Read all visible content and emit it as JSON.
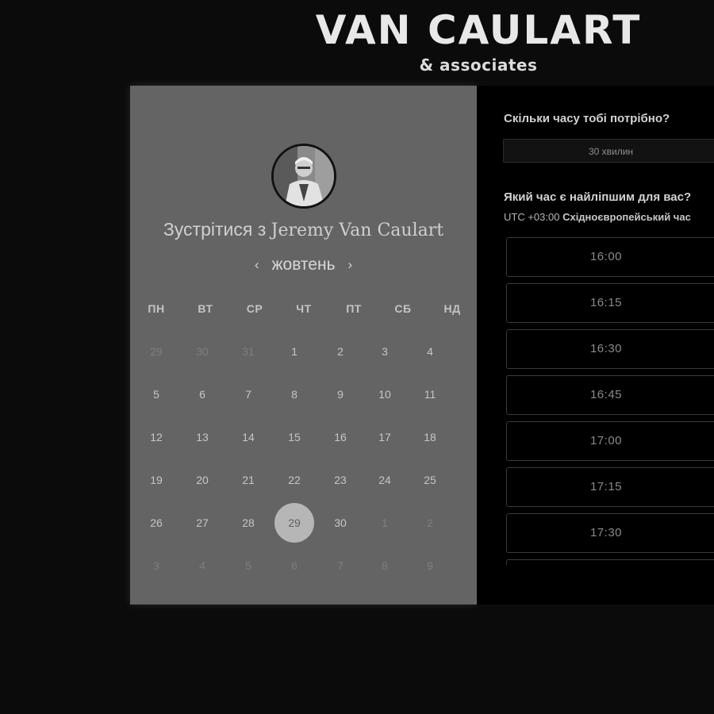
{
  "brand": {
    "title": "VAN CAULART",
    "subtitle": "& associates"
  },
  "host": {
    "prefix": "Зустрітися з",
    "name": "Jeremy Van Caulart",
    "avatar_icon": "host-avatar-photo"
  },
  "calendar": {
    "month": "жовтень",
    "prev_icon": "chevron-left-icon",
    "next_icon": "chevron-right-icon",
    "weekdays": [
      "ПН",
      "ВТ",
      "СР",
      "ЧТ",
      "ПТ",
      "СБ",
      "НД"
    ],
    "weeks": [
      [
        {
          "d": "29",
          "other": true
        },
        {
          "d": "30",
          "other": true
        },
        {
          "d": "31",
          "other": true
        },
        {
          "d": "1"
        },
        {
          "d": "2"
        },
        {
          "d": "3"
        },
        {
          "d": "4"
        }
      ],
      [
        {
          "d": "5"
        },
        {
          "d": "6"
        },
        {
          "d": "7"
        },
        {
          "d": "8"
        },
        {
          "d": "9"
        },
        {
          "d": "10"
        },
        {
          "d": "11"
        }
      ],
      [
        {
          "d": "12"
        },
        {
          "d": "13"
        },
        {
          "d": "14"
        },
        {
          "d": "15"
        },
        {
          "d": "16"
        },
        {
          "d": "17"
        },
        {
          "d": "18"
        }
      ],
      [
        {
          "d": "19"
        },
        {
          "d": "20"
        },
        {
          "d": "21"
        },
        {
          "d": "22"
        },
        {
          "d": "23"
        },
        {
          "d": "24"
        },
        {
          "d": "25"
        }
      ],
      [
        {
          "d": "26"
        },
        {
          "d": "27"
        },
        {
          "d": "28"
        },
        {
          "d": "29",
          "selected": true
        },
        {
          "d": "30"
        },
        {
          "d": "1",
          "other": true
        },
        {
          "d": "2",
          "other": true
        }
      ],
      [
        {
          "d": "3",
          "other": true
        },
        {
          "d": "4",
          "other": true
        },
        {
          "d": "5",
          "other": true
        },
        {
          "d": "6",
          "other": true
        },
        {
          "d": "7",
          "other": true
        },
        {
          "d": "8",
          "other": true
        },
        {
          "d": "9",
          "other": true
        }
      ]
    ]
  },
  "booking": {
    "duration_question": "Скільки часу тобі потрібно?",
    "duration_value": "30 хвилин",
    "time_question": "Який час є найліпшим для вас?",
    "timezone_offset": "UTC +03:00",
    "timezone_name": "Східноєвропейський час",
    "slots": [
      "16:00",
      "16:15",
      "16:30",
      "16:45",
      "17:00",
      "17:15",
      "17:30",
      ""
    ]
  },
  "colors": {
    "background": "#0b0b0b",
    "calendar_panel": "#646464",
    "selected_day": "#b6b6b6",
    "times_panel": "#000000"
  }
}
